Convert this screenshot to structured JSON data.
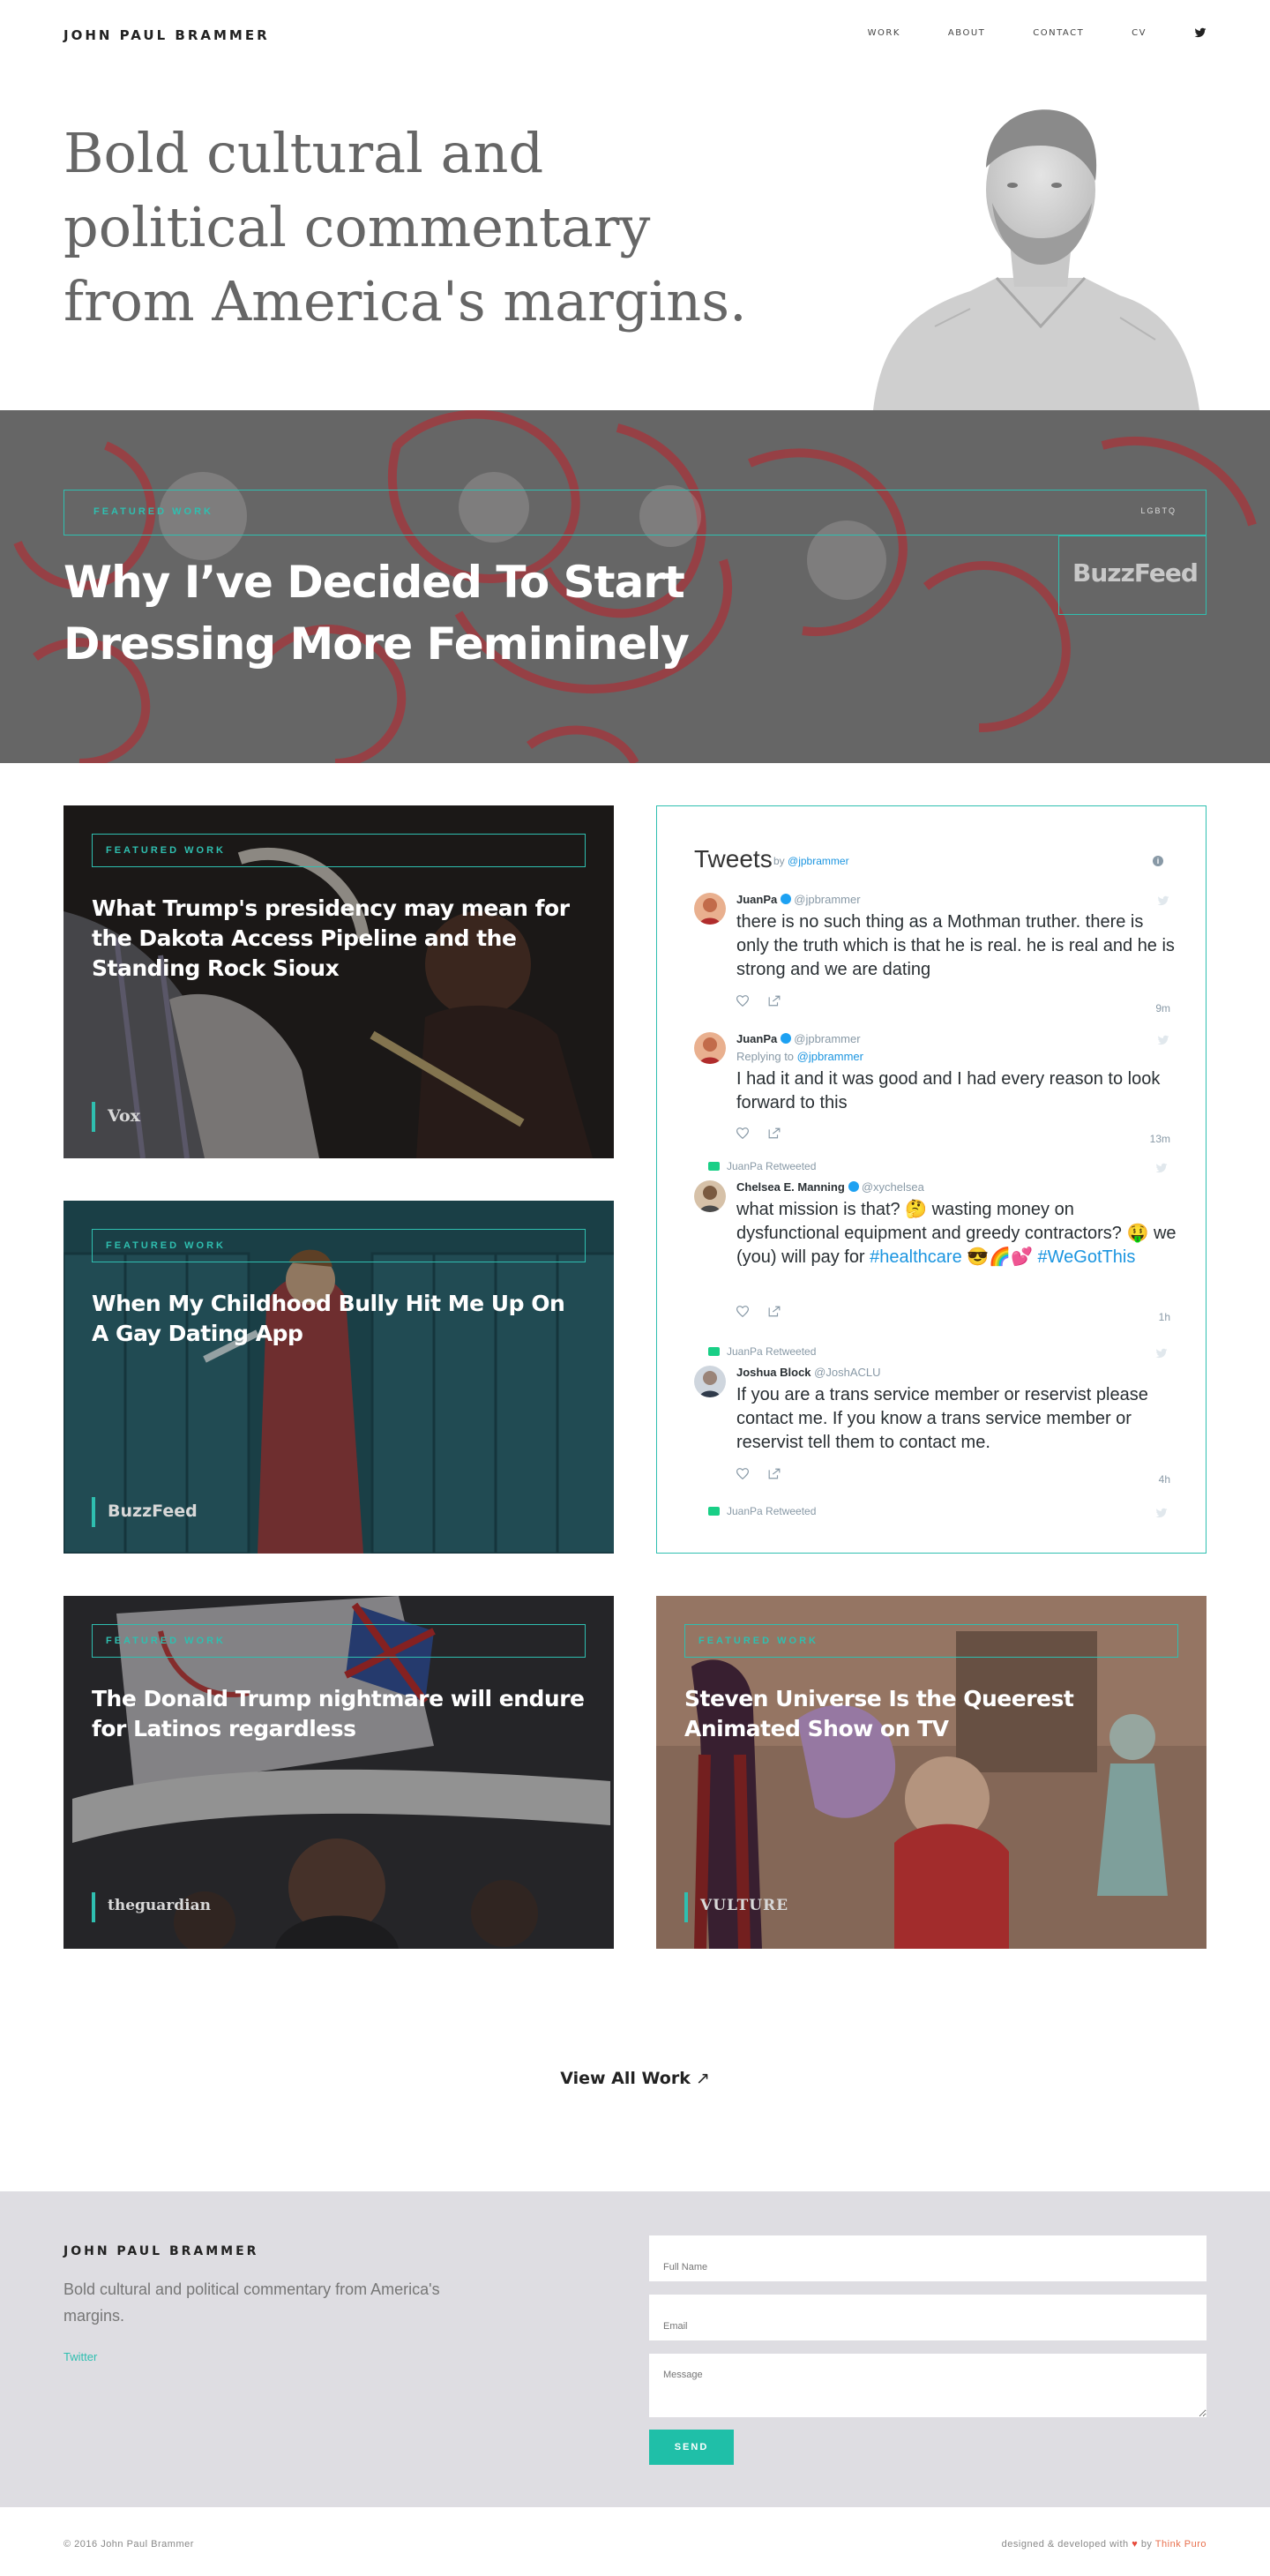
{
  "header": {
    "site_title": "JOHN PAUL BRAMMER",
    "nav": [
      "WORK",
      "ABOUT",
      "CONTACT",
      "CV"
    ]
  },
  "hero": {
    "tagline": "Bold cultural and political commentary from America's margins."
  },
  "banner": {
    "label": "FEATURED WORK",
    "tag": "LGBTQ",
    "title": "Why I’ve Decided To Start Dressing More Femininely",
    "source": "BuzzFeed"
  },
  "cards": [
    {
      "label": "FEATURED WORK",
      "title": "What Trump's presidency may mean for the Dakota Access Pipeline and the Standing Rock Sioux",
      "source": "Vox"
    },
    {
      "label": "FEATURED WORK",
      "title": "When My Childhood Bully Hit Me Up On A Gay Dating App",
      "source": "BuzzFeed"
    },
    {
      "label": "FEATURED WORK",
      "title": "The Donald Trump nightmare will endure for Latinos regardless",
      "source": "theguardian"
    },
    {
      "label": "FEATURED WORK",
      "title": "Steven Universe Is the Queerest Animated Show on TV",
      "source": "VULTURE"
    }
  ],
  "tweets": {
    "heading": "Tweets",
    "by": "by",
    "handle": "@jpbrammer",
    "items": [
      {
        "name": "JuanPa",
        "handle": "@jpbrammer",
        "text": "there is no such thing as a Mothman truther. there is only the truth which is that he is real. he is real and he is strong and we are dating",
        "time": "9m"
      },
      {
        "name": "JuanPa",
        "handle": "@jpbrammer",
        "reply_prefix": "Replying to",
        "reply_to": "@jpbrammer",
        "text": "I had it and it was good and I had every reason to look forward to this",
        "time": "13m"
      },
      {
        "retweet_by": "JuanPa Retweeted",
        "name": "Chelsea E. Manning",
        "handle": "@xychelsea",
        "text_a": "what mission is that? 🤔 wasting money on dysfunctional equipment and greedy contractors? 🤑 we (you) will pay for",
        "hashtag1": "#healthcare",
        "text_b": "😎🌈💕",
        "hashtag2": "#WeGotThis",
        "time": "1h"
      },
      {
        "retweet_by": "JuanPa Retweeted",
        "name": "Joshua Block",
        "handle": "@JoshACLU",
        "text": "If you are a trans service member or reservist please contact me. If you know a trans service member or reservist tell them to contact me.",
        "time": "4h"
      }
    ],
    "last_retweet": "JuanPa Retweeted"
  },
  "view_all": {
    "label": "View All Work",
    "arrow": "↗"
  },
  "footer": {
    "title": "JOHN PAUL BRAMMER",
    "description": "Bold cultural and political commentary from America's margins.",
    "twitter_link": "Twitter",
    "form": {
      "name_placeholder": "Full Name",
      "email_placeholder": "Email",
      "message_placeholder": "Message",
      "send_label": "SEND"
    },
    "copyright": "© 2016 John Paul Brammer",
    "credit_prefix": "designed & developed with",
    "credit_heart": "♥",
    "credit_by": "by",
    "credit_brand": "Think Puro"
  },
  "colors": {
    "accent": "#2fbfb0",
    "send_button": "#1fbfa8",
    "footer_bg": "#dedde2",
    "twitter_link": "#1b95e0"
  },
  "icons": [
    "twitter-bird-icon",
    "verified-check-icon",
    "like-heart-icon",
    "share-icon",
    "retweet-icon",
    "info-icon",
    "external-arrow-icon"
  ]
}
